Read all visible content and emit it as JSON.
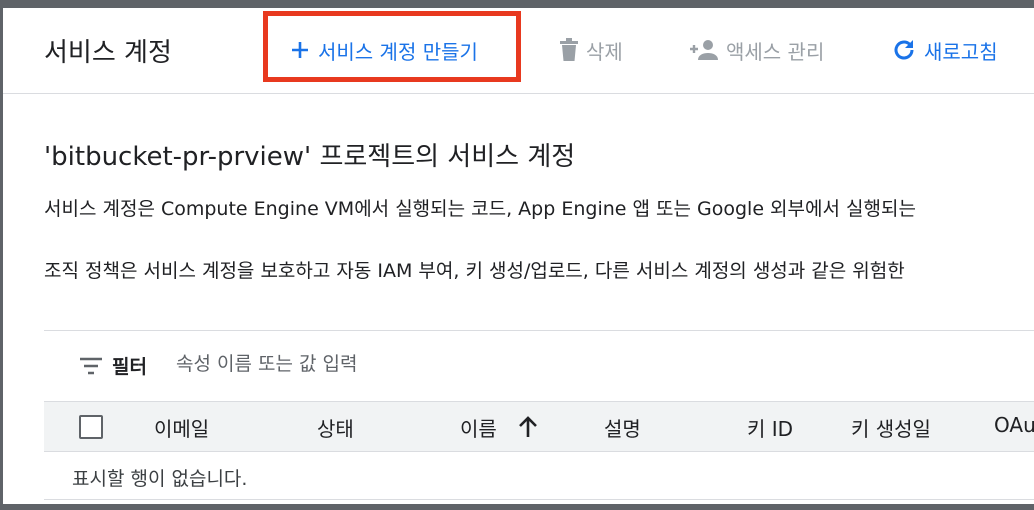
{
  "header": {
    "title": "서비스 계정",
    "create_label": "서비스 계정 만들기",
    "delete_label": "삭제",
    "access_label": "액세스 관리",
    "refresh_label": "새로고침"
  },
  "main": {
    "heading": "'bitbucket-pr-prview' 프로젝트의 서비스 계정",
    "description_1": "서비스 계정은 Compute Engine VM에서 실행되는 코드, App Engine 앱 또는 Google 외부에서 실행되는",
    "description_2": "조직 정책은 서비스 계정을 보호하고 자동 IAM 부여, 키 생성/업로드, 다른 서비스 계정의 생성과 같은 위험한"
  },
  "filter": {
    "label": "필터",
    "placeholder": "속성 이름 또는 값 입력"
  },
  "table": {
    "columns": [
      "이메일",
      "상태",
      "이름",
      "설명",
      "키 ID",
      "키 생성일",
      "OAu"
    ],
    "empty_message": "표시할 행이 없습니다."
  },
  "colors": {
    "accent": "#1a73e8",
    "disabled": "#9aa0a6",
    "highlight": "#e8391f"
  }
}
